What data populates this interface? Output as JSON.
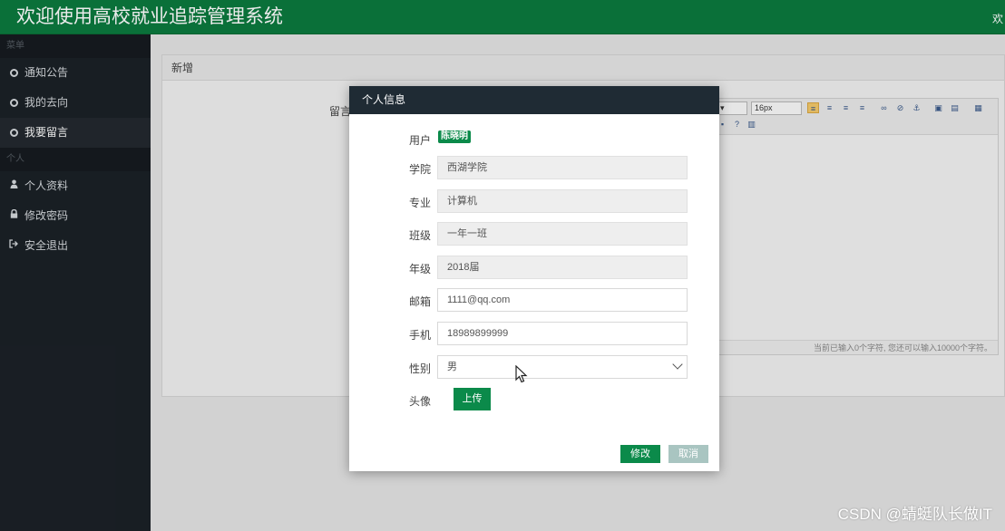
{
  "header": {
    "title": "欢迎使用高校就业追踪管理系统",
    "welcome": "欢"
  },
  "sidebar": {
    "section_menu": "菜单",
    "menu_items": [
      {
        "label": "通知公告",
        "icon": "circle-icon"
      },
      {
        "label": "我的去向",
        "icon": "circle-icon"
      },
      {
        "label": "我要留言",
        "icon": "circle-icon"
      }
    ],
    "section_personal": "个人",
    "personal_items": [
      {
        "label": "个人资料",
        "icon": "user-icon"
      },
      {
        "label": "修改密码",
        "icon": "lock-icon"
      },
      {
        "label": "安全退出",
        "icon": "logout-icon"
      }
    ]
  },
  "main": {
    "panel_title": "新增",
    "message_label": "留言",
    "editor": {
      "font_size": "16px",
      "footer": "当前已输入0个字符, 您还可以输入10000个字符。"
    }
  },
  "modal": {
    "title": "个人信息",
    "fields": {
      "user": {
        "label": "用户",
        "value": "陈晓明"
      },
      "college": {
        "label": "学院",
        "value": "西湖学院"
      },
      "major": {
        "label": "专业",
        "value": "计算机"
      },
      "class": {
        "label": "班级",
        "value": "一年一班"
      },
      "grade": {
        "label": "年级",
        "value": "2018届"
      },
      "email": {
        "label": "邮箱",
        "value": "1111@qq.com"
      },
      "phone": {
        "label": "手机",
        "value": "18989899999"
      },
      "gender": {
        "label": "性别",
        "value": "男"
      },
      "avatar": {
        "label": "头像"
      }
    },
    "upload_label": "上传",
    "save_label": "修改",
    "cancel_label": "取消"
  },
  "watermark": "CSDN @蜻蜓队长做IT",
  "colors": {
    "header": "#0b7a3e",
    "sidebar": "#1b2127",
    "accent": "#0b8a4a",
    "modal_header": "#1f2b34"
  }
}
